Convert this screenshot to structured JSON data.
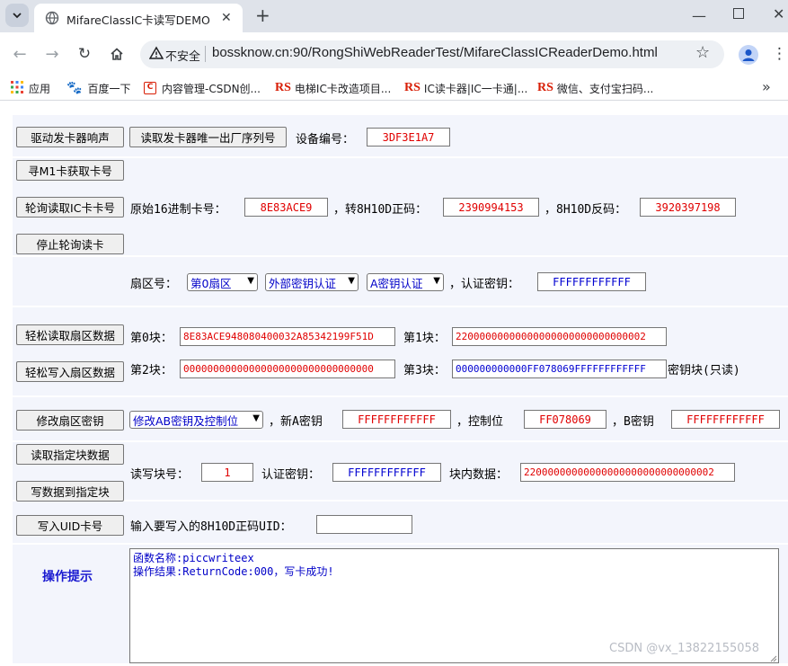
{
  "browser": {
    "tab_title": "MifareClassIC卡读写DEMO",
    "security_label": "不安全",
    "url": "bossknow.cn:90/RongShiWebReaderTest/MifareClassICReaderDemo.html",
    "bookmarks": [
      {
        "label": "应用"
      },
      {
        "label": "百度一下"
      },
      {
        "label": "内容管理-CSDN创..."
      },
      {
        "label": "电梯IC卡改造项目..."
      },
      {
        "label": "IC读卡器|IC一卡通|..."
      },
      {
        "label": "微信、支付宝扫码..."
      }
    ],
    "rs_mark": "RS"
  },
  "row1": {
    "beep_button": "驱动发卡器响声",
    "serial_button": "读取发卡器唯一出厂序列号",
    "device_label": "设备编号：",
    "device_value": "3DF3E1A7"
  },
  "row2": {
    "find_button": "寻M1卡获取卡号"
  },
  "row3": {
    "poll_button": "轮询读取IC卡卡号",
    "hex_label": "原始16进制卡号：",
    "hex_value": "8E83ACE9",
    "fwd_label": "，转8H10D正码：",
    "fwd_value": "2390994153",
    "rev_label": "，8H10D反码：",
    "rev_value": "3920397198"
  },
  "row4": {
    "stop_button": "停止轮询读卡"
  },
  "row5": {
    "sector_label": "扇区号：",
    "sector_select": "第0扇区",
    "auth_mode_select": "外部密钥认证",
    "key_type_select": "A密钥认证",
    "auth_key_label": "，认证密钥：",
    "auth_key_value": "FFFFFFFFFFFF"
  },
  "row6": {
    "read_sector_button": "轻松读取扇区数据",
    "block0_label": "第0块：",
    "block0_value": "8E83ACE948080400032A85342199F51D",
    "block1_label": "第1块：",
    "block1_value": "22000000000000000000000000000002"
  },
  "row7": {
    "write_sector_button": "轻松写入扇区数据",
    "block2_label": "第2块：",
    "block2_value": "00000000000000000000000000000000",
    "block3_label": "第3块：",
    "block3_value": "000000000000FF078069FFFFFFFFFFFF",
    "key_block_note": "密钥块(只读)"
  },
  "row8": {
    "change_key_button": "修改扇区密钥",
    "change_mode_select": "修改AB密钥及控制位",
    "new_a_label": "，新A密钥",
    "new_a_value": "FFFFFFFFFFFF",
    "ctrl_label": "，控制位",
    "ctrl_value": "FF078069",
    "b_key_label": "，B密钥",
    "b_key_value": "FFFFFFFFFFFF"
  },
  "row9": {
    "read_block_button": "读取指定块数据",
    "write_block_button": "写数据到指定块",
    "block_no_label": "读写块号：",
    "block_no_value": "1",
    "auth_key_label": "认证密钥：",
    "auth_key_value": "FFFFFFFFFFFF",
    "data_label": "块内数据：",
    "data_value": "22000000000000000000000000000002"
  },
  "row10": {
    "write_uid_button": "写入UID卡号",
    "uid_label": "输入要写入的8H10D正码UID：",
    "uid_value": ""
  },
  "hint": {
    "title": "操作提示",
    "log_line1": "函数名称:piccwriteex",
    "log_line2": "操作结果:ReturnCode:000，写卡成功!"
  },
  "watermark": "CSDN @vx_13822155058",
  "colors": {
    "value_red": "#e00000",
    "value_blue": "#0000d0",
    "row_bg": "#f3f5fc",
    "hint_title": "#1a1ad0"
  }
}
